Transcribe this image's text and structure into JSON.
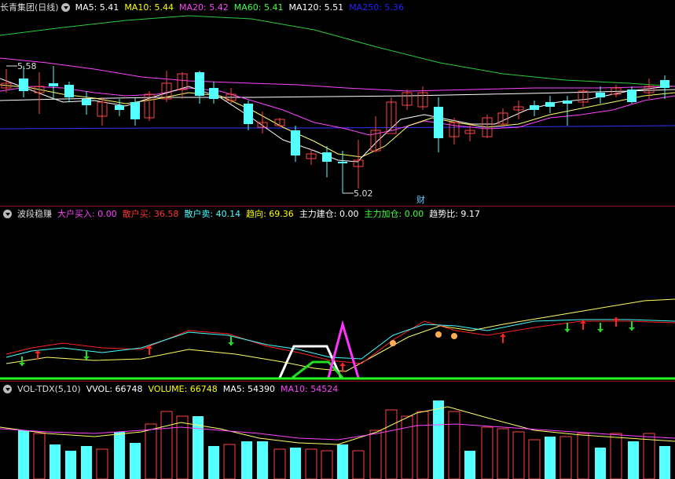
{
  "price_panel": {
    "stock_title": "长青集团(日线)",
    "ma_labels": [
      {
        "text": "MA5: 5.41",
        "color": "#ffffff"
      },
      {
        "text": "MA10: 5.44",
        "color": "#ffff00"
      },
      {
        "text": "MA20: 5.42",
        "color": "#ff44ff"
      },
      {
        "text": "MA60: 5.41",
        "color": "#44ff44"
      },
      {
        "text": "MA120: 5.51",
        "color": "#ffffff"
      },
      {
        "text": "MA250: 5.36",
        "color": "#2222ff"
      }
    ],
    "high_label": "5.58",
    "low_label": "5.02",
    "fin_marker": "财"
  },
  "indicator_panel": {
    "name": "波段稳赚",
    "values": [
      {
        "text": "大户买入: 0.00",
        "color": "#ff44ff"
      },
      {
        "text": "散户买: 36.58",
        "color": "#ff3333"
      },
      {
        "text": "散户卖: 40.14",
        "color": "#44ffff"
      },
      {
        "text": "趋向: 69.36",
        "color": "#ffff00"
      },
      {
        "text": "主力建仓: 0.00",
        "color": "#ffffff"
      },
      {
        "text": "主力加仓: 0.00",
        "color": "#44ff44"
      },
      {
        "text": "趋势比: 9.17",
        "color": "#ffffff"
      }
    ]
  },
  "volume_panel": {
    "name": "VOL-TDX(5,10)",
    "values": [
      {
        "text": "VVOL: 66748",
        "color": "#ffffff"
      },
      {
        "text": "VOLUME: 66748",
        "color": "#ffff00"
      },
      {
        "text": "MA5: 54390",
        "color": "#ffffff"
      },
      {
        "text": "MA10: 54524",
        "color": "#ff44ff"
      }
    ]
  },
  "colors": {
    "up": "#ff4444",
    "down": "#54ffff",
    "separator": "#8a1010",
    "background": "#000000"
  }
}
